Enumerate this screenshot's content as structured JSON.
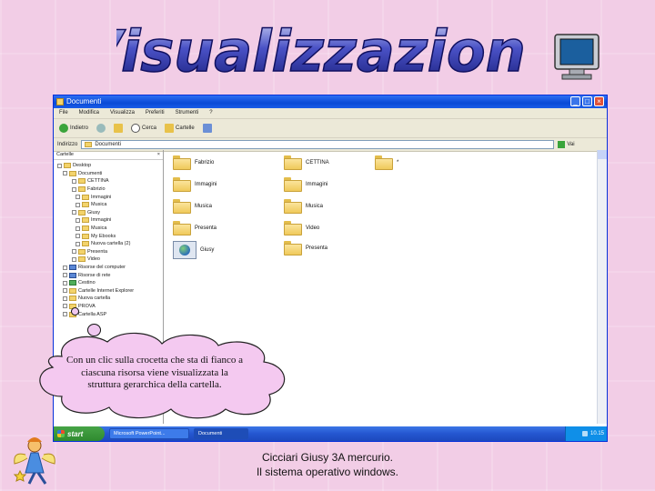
{
  "slide": {
    "title": "Visualizzazione",
    "callout": "Con un clic sulla crocetta che sta di fianco a ciascuna risorsa viene visualizzata la struttura gerarchica della cartella.",
    "footer_line1": "Cicciari Giusy 3A mercurio.",
    "footer_line2": "Il sistema operativo windows."
  },
  "icons": {
    "monitor": "monitor-icon",
    "fairy": "fairy-clipart-icon",
    "globe": "globe-icon",
    "folder": "folder-icon"
  },
  "colors": {
    "background": "#f2cde6",
    "title_fill": "#2a2fa3",
    "window_border": "#0831d9",
    "taskbar": "#2456d0",
    "start_button": "#47a447",
    "callout_fill": "#f4c9f0"
  },
  "explorer": {
    "window_title": "Documenti",
    "menu": [
      "File",
      "Modifica",
      "Visualizza",
      "Preferiti",
      "Strumenti",
      "?"
    ],
    "toolbar": {
      "back": "Indietro",
      "search": "Cerca",
      "folders": "Cartelle"
    },
    "address": {
      "label": "Indirizzo",
      "value": "Documenti",
      "go": "Vai"
    },
    "left_pane": {
      "header": "Cartelle",
      "tree": [
        {
          "label": "Desktop",
          "kind": "desktop"
        },
        {
          "label": "Documenti",
          "kind": "folder"
        },
        {
          "label": "CETTINA",
          "kind": "folder"
        },
        {
          "label": "Fabrizio",
          "kind": "folder"
        },
        {
          "label": "Immagini",
          "kind": "folder"
        },
        {
          "label": "Musica",
          "kind": "folder"
        },
        {
          "label": "Giusy",
          "kind": "folder"
        },
        {
          "label": "Immagini",
          "kind": "folder"
        },
        {
          "label": "Musica",
          "kind": "folder"
        },
        {
          "label": "My Ebooks",
          "kind": "folder"
        },
        {
          "label": "Nuova cartella (2)",
          "kind": "folder"
        },
        {
          "label": "Presenta",
          "kind": "folder"
        },
        {
          "label": "Video",
          "kind": "folder"
        },
        {
          "label": "Risorse del computer",
          "kind": "computer"
        },
        {
          "label": "Risorse di rete",
          "kind": "network"
        },
        {
          "label": "Cestino",
          "kind": "bin"
        },
        {
          "label": "Cartelle Internet Explorer",
          "kind": "folder"
        },
        {
          "label": "Nuova cartella",
          "kind": "folder"
        },
        {
          "label": "PROVA",
          "kind": "folder"
        },
        {
          "label": "Cartella ASP",
          "kind": "folder"
        }
      ]
    },
    "files": [
      {
        "label": "Fabrizio",
        "kind": "folder"
      },
      {
        "label": "CETTINA",
        "kind": "folder"
      },
      {
        "label": "*",
        "kind": "folder"
      },
      {
        "label": "Immagini",
        "kind": "folder"
      },
      {
        "label": "Immagini",
        "kind": "folder-special"
      },
      {
        "label": "Musica",
        "kind": "folder"
      },
      {
        "label": "Musica",
        "kind": "folder"
      },
      {
        "label": "Presenta",
        "kind": "folder"
      },
      {
        "label": "Video",
        "kind": "folder"
      },
      {
        "label": "Giusy",
        "kind": "globe"
      },
      {
        "label": "Presenta",
        "kind": "folder-special"
      }
    ]
  },
  "taskbar": {
    "start": "start",
    "tasks": [
      "Microsoft PowerPoint...",
      "Documenti"
    ],
    "clock": "10.15"
  }
}
